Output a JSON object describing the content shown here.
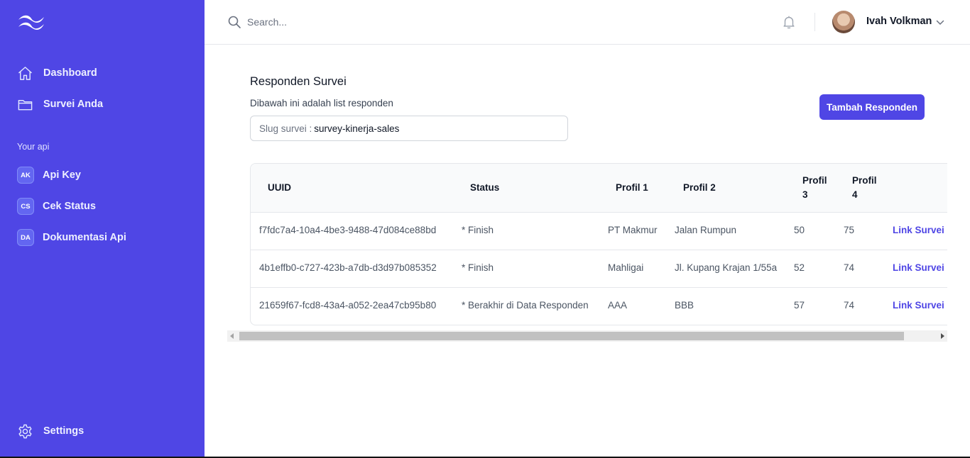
{
  "sidebar": {
    "nav": [
      {
        "label": "Dashboard",
        "icon": "home-icon"
      },
      {
        "label": "Survei Anda",
        "icon": "folder-icon"
      }
    ],
    "section_label": "Your api",
    "api_items": [
      {
        "badge": "AK",
        "label": "Api Key"
      },
      {
        "badge": "CS",
        "label": "Cek Status"
      },
      {
        "badge": "DA",
        "label": "Dokumentasi Api"
      }
    ],
    "settings_label": "Settings"
  },
  "header": {
    "search_placeholder": "Search...",
    "user_name": "Ivah Volkman"
  },
  "main": {
    "title": "Responden Survei",
    "subtitle": "Dibawah ini adalah list responden",
    "slug_label": "Slug survei :",
    "slug_value": "survey-kinerja-sales",
    "add_button": "Tambah Responden"
  },
  "table": {
    "headers": {
      "uuid": "UUID",
      "status": "Status",
      "profil1": "Profil 1",
      "profil2": "Profil 2",
      "profil3": "Profil 3",
      "profil4": "Profil 4"
    },
    "rows": [
      {
        "uuid": "f7fdc7a4-10a4-4be3-9488-47d084ce88bd",
        "status": "* Finish",
        "profil1": "PT Makmur",
        "profil2": "Jalan Rumpun",
        "profil3": "50",
        "profil4": "75",
        "link": "Link Survei"
      },
      {
        "uuid": "4b1effb0-c727-423b-a7db-d3d97b085352",
        "status": "* Finish",
        "profil1": "Mahligai",
        "profil2": "Jl. Kupang Krajan 1/55a",
        "profil3": "52",
        "profil4": "74",
        "link": "Link Survei"
      },
      {
        "uuid": "21659f67-fcd8-43a4-a052-2ea47cb95b80",
        "status": "* Berakhir di Data Responden",
        "profil1": "AAA",
        "profil2": "BBB",
        "profil3": "57",
        "profil4": "74",
        "link": "Link Survei"
      }
    ]
  },
  "colors": {
    "primary": "#4f46e5",
    "sidebar_bg": "#4f46e5"
  }
}
